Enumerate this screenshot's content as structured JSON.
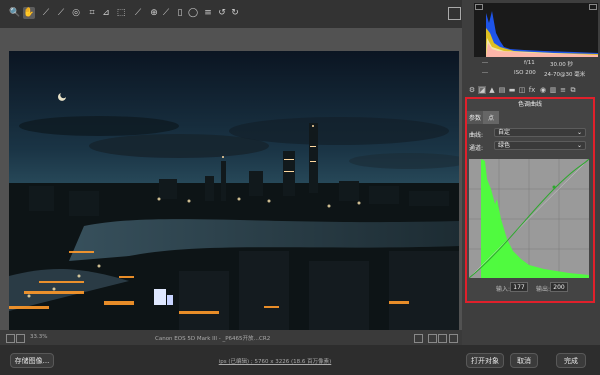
{
  "toolbar": {
    "tools": [
      {
        "icon": "zoom-icon",
        "glyph": "🔍"
      },
      {
        "icon": "hand-icon",
        "glyph": "✋"
      },
      {
        "icon": "white-balance-icon",
        "glyph": "⟋"
      },
      {
        "icon": "color-sampler-icon",
        "glyph": "⟋"
      },
      {
        "icon": "targeted-adjust-icon",
        "glyph": "◎"
      },
      {
        "icon": "crop-icon",
        "glyph": "⌗"
      },
      {
        "icon": "straighten-icon",
        "glyph": "⊿"
      },
      {
        "icon": "transform-icon",
        "glyph": "⬚"
      },
      {
        "icon": "spot-removal-icon",
        "glyph": "⟋"
      },
      {
        "icon": "red-eye-icon",
        "glyph": "⊕"
      },
      {
        "icon": "adjustment-brush-icon",
        "glyph": "⟋"
      },
      {
        "icon": "graduated-filter-icon",
        "glyph": "▯"
      },
      {
        "icon": "radial-filter-icon",
        "glyph": "◯"
      },
      {
        "icon": "preferences-icon",
        "glyph": "≡"
      },
      {
        "icon": "rotate-ccw-icon",
        "glyph": "↺"
      },
      {
        "icon": "rotate-cw-icon",
        "glyph": "↻"
      }
    ]
  },
  "camera": {
    "left_top": "---",
    "left_bottom": "---",
    "aperture": "f/11",
    "shutter": "30.00 秒",
    "iso": "ISO 200",
    "lens": "24-70@30 毫米"
  },
  "panel": {
    "section_title": "色调曲线",
    "tabs": [
      "参数",
      "点"
    ],
    "curve_label": "曲线:",
    "curve_value": "自定",
    "channel_label": "通道:",
    "channel_value": "绿色",
    "input_label": "输入:",
    "input_value": "177",
    "output_label": "输出:",
    "output_value": "200"
  },
  "status": {
    "zoom": "33.3%",
    "filename": "Canon EOS 5D Mark III - _P6465开放…CR2"
  },
  "bottom": {
    "save_label": "存储图像...",
    "workflow_text": "ips (已编辑) ; 5760 x 3226 (18.6 百万像素)",
    "open_label": "打开对象",
    "cancel_label": "取消",
    "done_label": "完成"
  },
  "colors": {
    "accent_red": "#e0202b",
    "curve_green": "#4cff3a"
  }
}
